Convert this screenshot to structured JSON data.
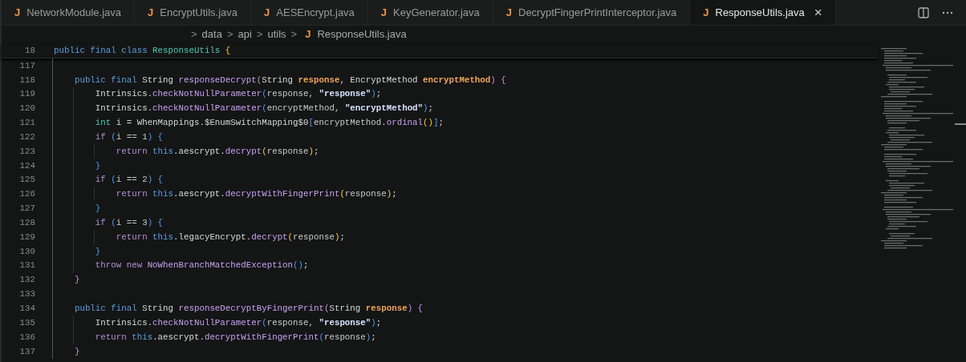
{
  "tabs": [
    {
      "label": "NetworkModule.java",
      "icon": "J",
      "selected": false
    },
    {
      "label": "EncryptUtils.java",
      "icon": "J",
      "selected": false
    },
    {
      "label": "AESEncrypt.java",
      "icon": "J",
      "selected": false
    },
    {
      "label": "KeyGenerator.java",
      "icon": "J",
      "selected": false
    },
    {
      "label": "DecryptFingerPrintInterceptor.java",
      "icon": "J",
      "selected": false
    },
    {
      "label": "ResponseUtils.java",
      "icon": "J",
      "selected": true,
      "close": "×"
    }
  ],
  "breadcrumb": {
    "separator": ">",
    "items": [
      {
        "label": "data"
      },
      {
        "label": "api"
      },
      {
        "label": "utils"
      },
      {
        "label": "ResponseUtils.java",
        "icon": "J"
      }
    ]
  },
  "sticky_line": {
    "number": "18",
    "tokens": [
      {
        "kind": "kw",
        "text": "public final class "
      },
      {
        "kind": "type",
        "text": "ResponseUtils "
      },
      {
        "kind": "b1",
        "text": "{"
      }
    ]
  },
  "lines": [
    {
      "number": "117"
    },
    {
      "number": "118",
      "tokens": [
        {
          "kind": "kw",
          "text": "    public final "
        },
        {
          "kind": "plain",
          "text": "String "
        },
        {
          "kind": "fn",
          "text": "responseDecrypt"
        },
        {
          "kind": "b2",
          "text": "("
        },
        {
          "kind": "plain",
          "text": "String "
        },
        {
          "kind": "param",
          "text": "response"
        },
        {
          "kind": "plain",
          "text": ", EncryptMethod "
        },
        {
          "kind": "param",
          "text": "encryptMethod"
        },
        {
          "kind": "b2",
          "text": ") {"
        }
      ]
    },
    {
      "number": "119",
      "tokens": [
        {
          "kind": "plain",
          "text": "        Intrinsics."
        },
        {
          "kind": "fn",
          "text": "checkNotNullParameter"
        },
        {
          "kind": "b3",
          "text": "("
        },
        {
          "kind": "dim",
          "text": "response, "
        },
        {
          "kind": "str",
          "text": "\"response\""
        },
        {
          "kind": "b3",
          "text": ")"
        },
        {
          "kind": "plain",
          "text": ";"
        }
      ]
    },
    {
      "number": "120",
      "tokens": [
        {
          "kind": "plain",
          "text": "        Intrinsics."
        },
        {
          "kind": "fn",
          "text": "checkNotNullParameter"
        },
        {
          "kind": "b3",
          "text": "("
        },
        {
          "kind": "dim",
          "text": "encryptMethod, "
        },
        {
          "kind": "str",
          "text": "\"encryptMethod\""
        },
        {
          "kind": "b3",
          "text": ")"
        },
        {
          "kind": "plain",
          "text": ";"
        }
      ]
    },
    {
      "number": "121",
      "tokens": [
        {
          "kind": "type",
          "text": "        int "
        },
        {
          "kind": "plain",
          "text": "i = WhenMappings.$EnumSwitchMapping$0"
        },
        {
          "kind": "b3",
          "text": "["
        },
        {
          "kind": "dim",
          "text": "encryptMethod."
        },
        {
          "kind": "fn",
          "text": "ordinal"
        },
        {
          "kind": "b1",
          "text": "()"
        },
        {
          "kind": "b3",
          "text": "]"
        },
        {
          "kind": "plain",
          "text": ";"
        }
      ]
    },
    {
      "number": "122",
      "tokens": [
        {
          "kind": "ctrl",
          "text": "        if "
        },
        {
          "kind": "b3",
          "text": "("
        },
        {
          "kind": "dim",
          "text": "i == 1"
        },
        {
          "kind": "b3",
          "text": ") {"
        }
      ]
    },
    {
      "number": "123",
      "tokens": [
        {
          "kind": "ctrl",
          "text": "            return "
        },
        {
          "kind": "kw",
          "text": "this"
        },
        {
          "kind": "plain",
          "text": ".aescrypt."
        },
        {
          "kind": "fn",
          "text": "decrypt"
        },
        {
          "kind": "b1",
          "text": "("
        },
        {
          "kind": "dim",
          "text": "response"
        },
        {
          "kind": "b1",
          "text": ")"
        },
        {
          "kind": "plain",
          "text": ";"
        }
      ]
    },
    {
      "number": "124",
      "tokens": [
        {
          "kind": "b3",
          "text": "        }"
        }
      ]
    },
    {
      "number": "125",
      "tokens": [
        {
          "kind": "ctrl",
          "text": "        if "
        },
        {
          "kind": "b3",
          "text": "("
        },
        {
          "kind": "dim",
          "text": "i == 2"
        },
        {
          "kind": "b3",
          "text": ") {"
        }
      ]
    },
    {
      "number": "126",
      "tokens": [
        {
          "kind": "ctrl",
          "text": "            return "
        },
        {
          "kind": "kw",
          "text": "this"
        },
        {
          "kind": "plain",
          "text": ".aescrypt."
        },
        {
          "kind": "fn",
          "text": "decryptWithFingerPrint"
        },
        {
          "kind": "b1",
          "text": "("
        },
        {
          "kind": "dim",
          "text": "response"
        },
        {
          "kind": "b1",
          "text": ")"
        },
        {
          "kind": "plain",
          "text": ";"
        }
      ]
    },
    {
      "number": "127",
      "tokens": [
        {
          "kind": "b3",
          "text": "        }"
        }
      ]
    },
    {
      "number": "128",
      "tokens": [
        {
          "kind": "ctrl",
          "text": "        if "
        },
        {
          "kind": "b3",
          "text": "("
        },
        {
          "kind": "dim",
          "text": "i == 3"
        },
        {
          "kind": "b3",
          "text": ") {"
        }
      ]
    },
    {
      "number": "129",
      "tokens": [
        {
          "kind": "ctrl",
          "text": "            return "
        },
        {
          "kind": "kw",
          "text": "this"
        },
        {
          "kind": "plain",
          "text": ".legacyEncrypt."
        },
        {
          "kind": "fn",
          "text": "decrypt"
        },
        {
          "kind": "b1",
          "text": "("
        },
        {
          "kind": "dim",
          "text": "response"
        },
        {
          "kind": "b1",
          "text": ")"
        },
        {
          "kind": "plain",
          "text": ";"
        }
      ]
    },
    {
      "number": "130",
      "tokens": [
        {
          "kind": "b3",
          "text": "        }"
        }
      ]
    },
    {
      "number": "131",
      "tokens": [
        {
          "kind": "ctrl",
          "text": "        throw new "
        },
        {
          "kind": "fn",
          "text": "NoWhenBranchMatchedException"
        },
        {
          "kind": "b3",
          "text": "()"
        },
        {
          "kind": "plain",
          "text": ";"
        }
      ]
    },
    {
      "number": "132",
      "tokens": [
        {
          "kind": "b2",
          "text": "    }"
        }
      ]
    },
    {
      "number": "133"
    },
    {
      "number": "134",
      "tokens": [
        {
          "kind": "kw",
          "text": "    public final "
        },
        {
          "kind": "plain",
          "text": "String "
        },
        {
          "kind": "fn",
          "text": "responseDecryptByFingerPrint"
        },
        {
          "kind": "b2",
          "text": "("
        },
        {
          "kind": "plain",
          "text": "String "
        },
        {
          "kind": "param",
          "text": "response"
        },
        {
          "kind": "b2",
          "text": ") {"
        }
      ]
    },
    {
      "number": "135",
      "tokens": [
        {
          "kind": "plain",
          "text": "        Intrinsics."
        },
        {
          "kind": "fn",
          "text": "checkNotNullParameter"
        },
        {
          "kind": "b3",
          "text": "("
        },
        {
          "kind": "dim",
          "text": "response, "
        },
        {
          "kind": "str",
          "text": "\"response\""
        },
        {
          "kind": "b3",
          "text": ")"
        },
        {
          "kind": "plain",
          "text": ";"
        }
      ]
    },
    {
      "number": "136",
      "tokens": [
        {
          "kind": "ctrl",
          "text": "        return "
        },
        {
          "kind": "kw",
          "text": "this"
        },
        {
          "kind": "plain",
          "text": ".aescrypt."
        },
        {
          "kind": "fn",
          "text": "decryptWithFingerPrint"
        },
        {
          "kind": "b3",
          "text": "("
        },
        {
          "kind": "dim",
          "text": "response"
        },
        {
          "kind": "b3",
          "text": ")"
        },
        {
          "kind": "plain",
          "text": ";"
        }
      ]
    },
    {
      "number": "137",
      "tokens": [
        {
          "kind": "b2",
          "text": "    }"
        }
      ]
    }
  ]
}
